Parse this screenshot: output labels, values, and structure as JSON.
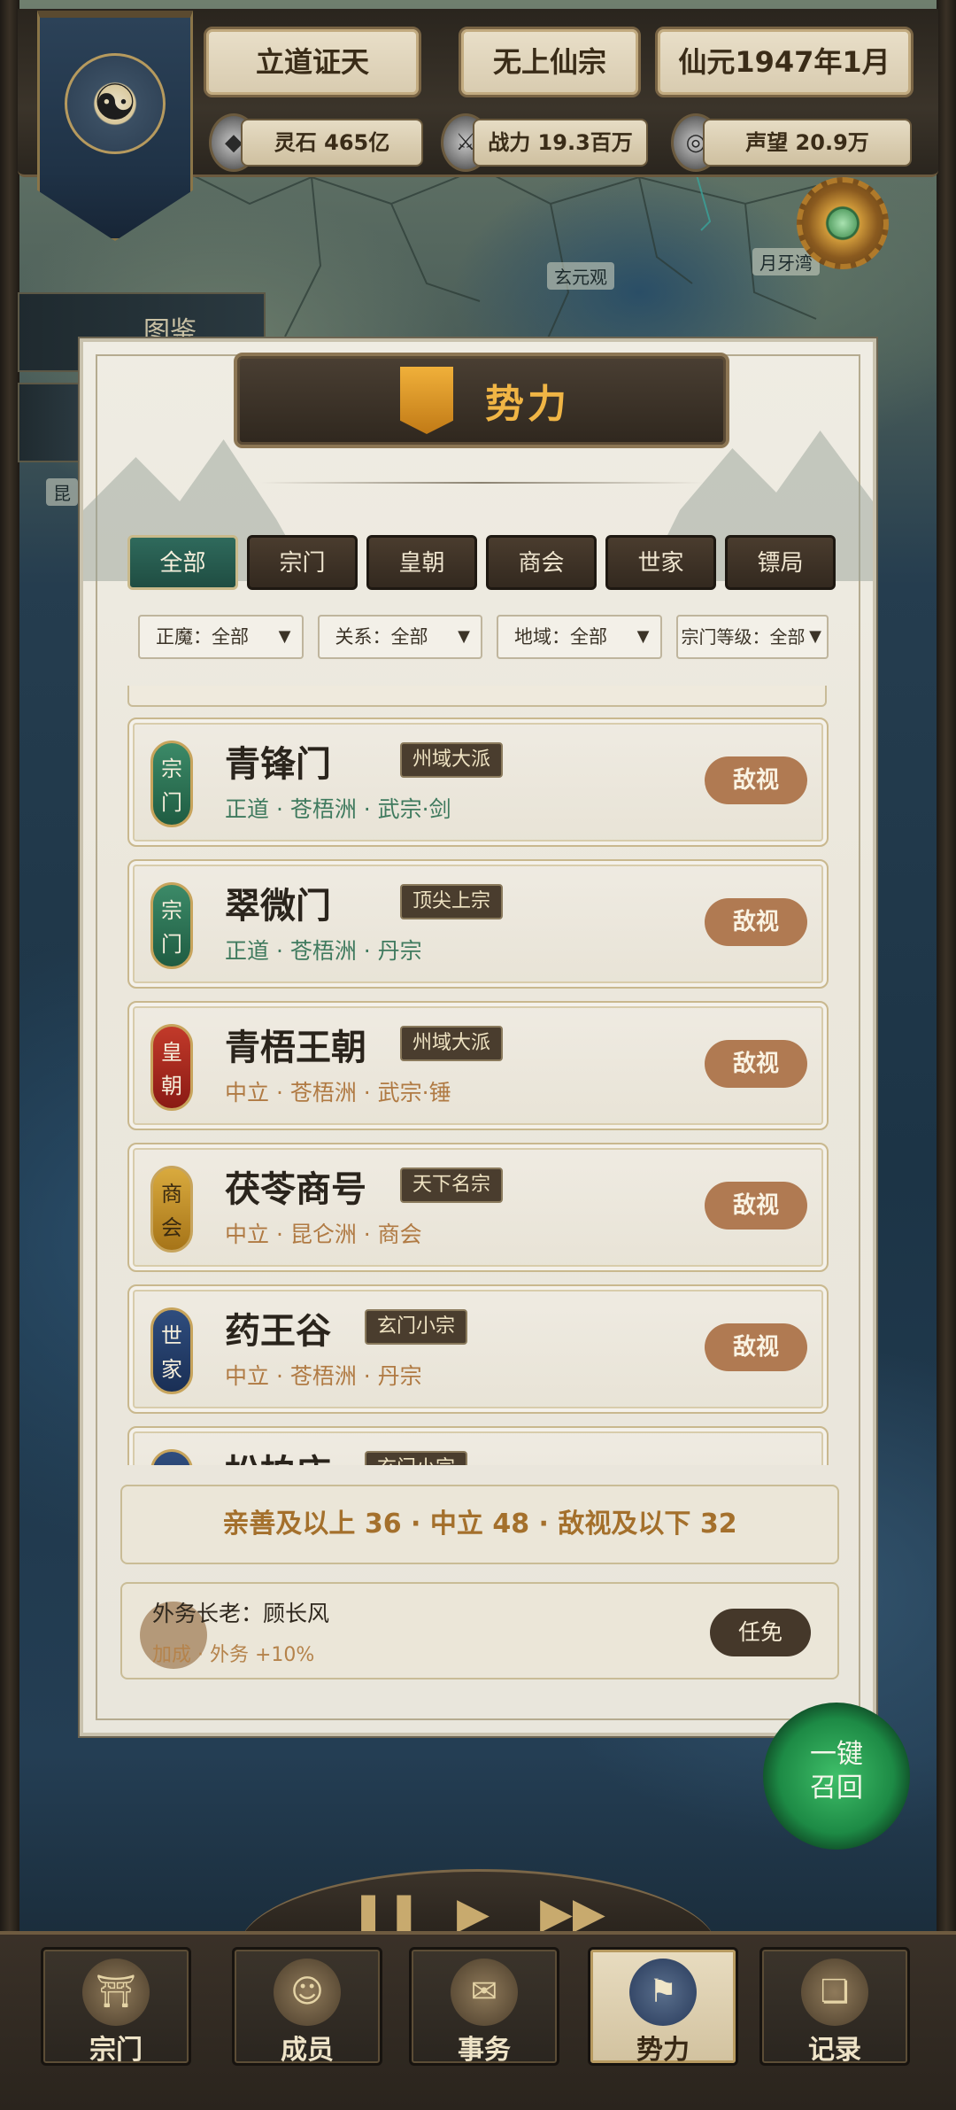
{
  "hud": {
    "title_left": "立道证天",
    "title_mid": "无上仙宗",
    "title_right": "仙元1947年1月",
    "spirit_stones": "灵石 465亿",
    "combat_power": "战力 19.3百万",
    "reputation": "声望 20.9万"
  },
  "map": {
    "labels": [
      "玄元观",
      "月牙湾",
      "昆"
    ],
    "side_tab": "图鉴"
  },
  "panel": {
    "title": "势力",
    "tabs": [
      {
        "label": "全部",
        "active": true
      },
      {
        "label": "宗门",
        "active": false
      },
      {
        "label": "皇朝",
        "active": false
      },
      {
        "label": "商会",
        "active": false
      },
      {
        "label": "世家",
        "active": false
      },
      {
        "label": "镖局",
        "active": false
      }
    ],
    "filters": [
      "正魔：全部",
      "关系：全部",
      "地域：全部",
      "宗门等级：全部"
    ],
    "factions": [
      {
        "type": [
          "宗",
          "门"
        ],
        "badge_color": "green",
        "name": "青锋门",
        "rank": "州域大派",
        "desc": "正道 · 苍梧洲 · 武宗·剑",
        "alignment": "righteous",
        "relation": "敌视"
      },
      {
        "type": [
          "宗",
          "门"
        ],
        "badge_color": "green",
        "name": "翠微门",
        "rank": "顶尖上宗",
        "desc": "正道 · 苍梧洲 · 丹宗",
        "alignment": "righteous",
        "relation": "敌视"
      },
      {
        "type": [
          "皇",
          "朝"
        ],
        "badge_color": "red",
        "name": "青梧王朝",
        "rank": "州域大派",
        "desc": "中立 · 苍梧洲 · 武宗·锤",
        "alignment": "neutral",
        "relation": "敌视"
      },
      {
        "type": [
          "商",
          "会"
        ],
        "badge_color": "gold",
        "name": "茯苓商号",
        "rank": "天下名宗",
        "desc": "中立 · 昆仑洲 · 商会",
        "alignment": "neutral",
        "relation": "敌视"
      },
      {
        "type": [
          "世",
          "家"
        ],
        "badge_color": "navy",
        "name": "药王谷",
        "rank": "玄门小宗",
        "desc": "中立 · 苍梧洲 · 丹宗",
        "alignment": "neutral",
        "relation": "敌视"
      },
      {
        "type": [
          "世",
          "家"
        ],
        "badge_color": "navy",
        "name": "松柏庄",
        "rank": "玄门小宗",
        "desc": "",
        "alignment": "neutral",
        "relation": ""
      }
    ],
    "summary": "亲善及以上 36 · 中立 48 · 敌视及以下 32",
    "elder": {
      "title": "外务长老：顾长风",
      "bonus": "加成 · 外务 +10%",
      "appoint_label": "任免"
    }
  },
  "recall": {
    "line1": "一键",
    "line2": "召回"
  },
  "speed_controls": [
    "pause",
    "play",
    "fast-forward"
  ],
  "nav": [
    {
      "label": "宗门",
      "icon": "pagoda-icon",
      "active": false
    },
    {
      "label": "成员",
      "icon": "person-icon",
      "active": false
    },
    {
      "label": "事务",
      "icon": "scroll-icon",
      "active": false
    },
    {
      "label": "势力",
      "icon": "banner-icon",
      "active": true
    },
    {
      "label": "记录",
      "icon": "book-icon",
      "active": false
    }
  ]
}
